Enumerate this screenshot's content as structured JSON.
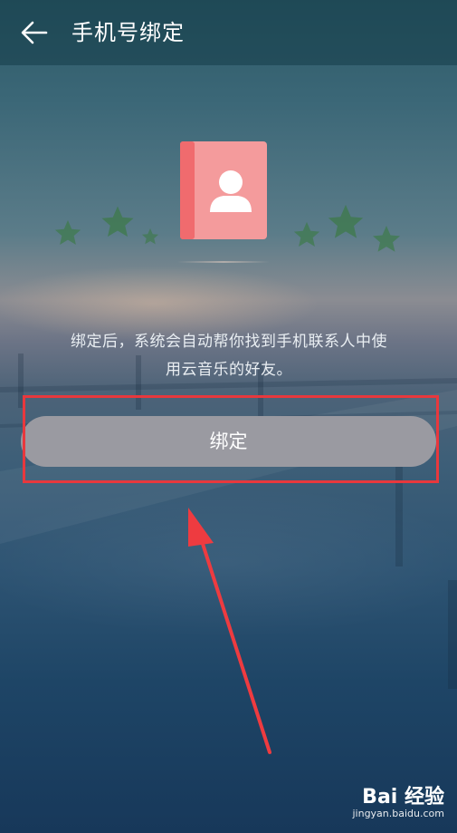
{
  "header": {
    "title": "手机号绑定",
    "back_icon": "arrow-left-icon"
  },
  "hero": {
    "icon": "contact-book-icon",
    "icon_color": "#f49b9c",
    "spine_color": "#f06b6e",
    "decoration": "star-icon"
  },
  "description": {
    "line1": "绑定后，系统会自动帮你找到手机联系人中使",
    "line2": "用云音乐的好友。"
  },
  "bind_button": {
    "label": "绑定"
  },
  "annotation": {
    "highlight_color": "#e8383d",
    "arrow_icon": "red-arrow-icon"
  },
  "watermark": {
    "logo": "Bai 经验",
    "url": "jingyan.baidu.com"
  }
}
